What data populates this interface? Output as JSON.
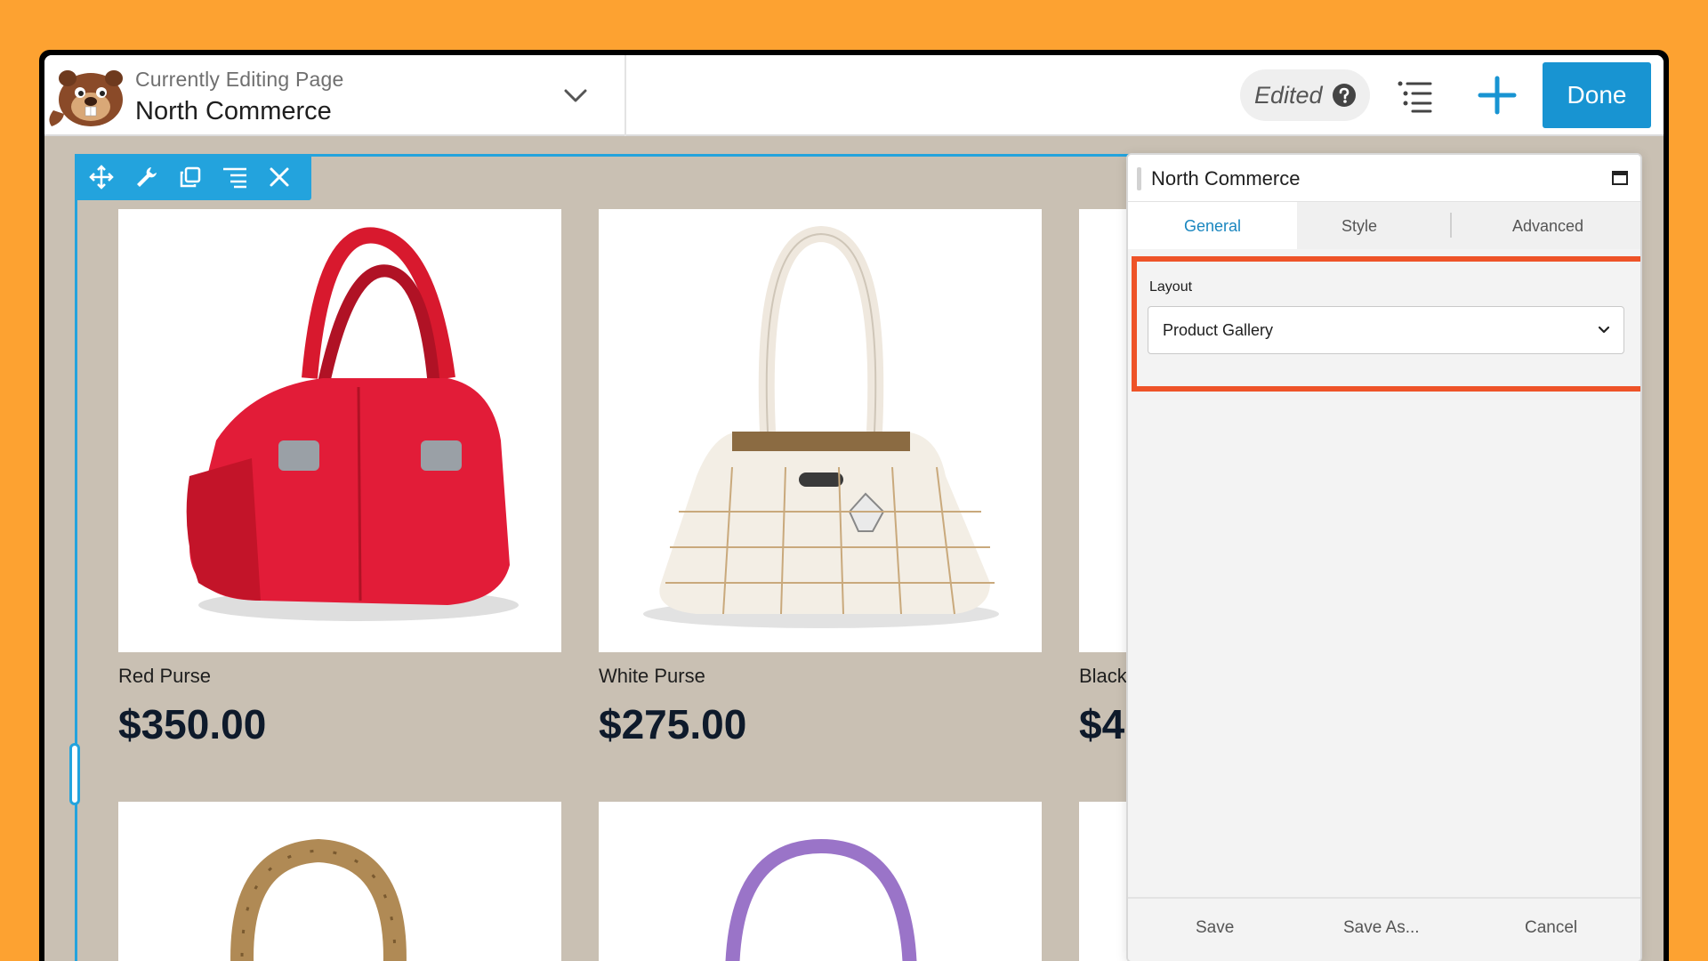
{
  "topbar": {
    "label": "Currently Editing Page",
    "page_name": "North Commerce",
    "status": "Edited",
    "done_label": "Done"
  },
  "products": [
    {
      "name": "Red Purse",
      "price": "$350.00"
    },
    {
      "name": "White Purse",
      "price": "$275.00"
    },
    {
      "name": "Black",
      "price": "$4"
    }
  ],
  "panel": {
    "title": "North Commerce",
    "tabs": [
      {
        "label": "General",
        "active": true
      },
      {
        "label": "Style",
        "active": false
      },
      {
        "label": "Advanced",
        "active": false
      }
    ],
    "layout_label": "Layout",
    "layout_value": "Product Gallery",
    "footer": {
      "save": "Save",
      "save_as": "Save As...",
      "cancel": "Cancel"
    }
  },
  "colors": {
    "background": "#FDA231",
    "accent": "#1894d2",
    "highlight": "#ee5328",
    "canvas": "#c9c0b3"
  }
}
